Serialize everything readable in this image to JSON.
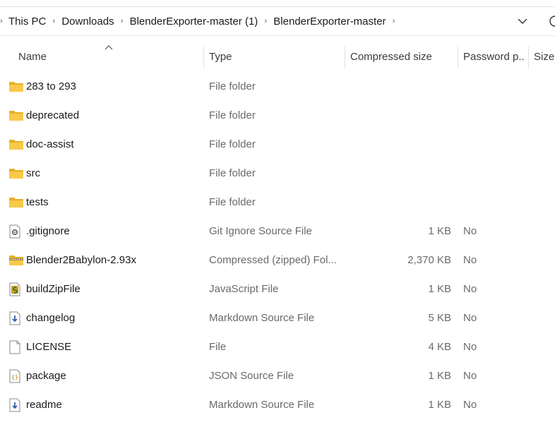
{
  "breadcrumb": {
    "items": [
      "This PC",
      "Downloads",
      "BlenderExporter-master (1)",
      "BlenderExporter-master"
    ]
  },
  "columns": {
    "name": "Name",
    "type": "Type",
    "compressed_size": "Compressed size",
    "password": "Password p...",
    "size": "Size"
  },
  "files": [
    {
      "name": "283 to 293",
      "type": "File folder",
      "compressed_size": "",
      "password": "",
      "icon": "folder-icon"
    },
    {
      "name": "deprecated",
      "type": "File folder",
      "compressed_size": "",
      "password": "",
      "icon": "folder-icon"
    },
    {
      "name": "doc-assist",
      "type": "File folder",
      "compressed_size": "",
      "password": "",
      "icon": "folder-icon"
    },
    {
      "name": "src",
      "type": "File folder",
      "compressed_size": "",
      "password": "",
      "icon": "folder-icon"
    },
    {
      "name": "tests",
      "type": "File folder",
      "compressed_size": "",
      "password": "",
      "icon": "folder-icon"
    },
    {
      "name": ".gitignore",
      "type": "Git Ignore Source File",
      "compressed_size": "1 KB",
      "password": "No",
      "icon": "gear-file-icon"
    },
    {
      "name": "Blender2Babylon-2.93x",
      "type": "Compressed (zipped) Fol...",
      "compressed_size": "2,370 KB",
      "password": "No",
      "icon": "zip-folder-icon"
    },
    {
      "name": "buildZipFile",
      "type": "JavaScript File",
      "compressed_size": "1 KB",
      "password": "No",
      "icon": "javascript-file-icon"
    },
    {
      "name": "changelog",
      "type": "Markdown Source File",
      "compressed_size": "5 KB",
      "password": "No",
      "icon": "markdown-file-icon"
    },
    {
      "name": "LICENSE",
      "type": "File",
      "compressed_size": "4 KB",
      "password": "No",
      "icon": "blank-file-icon"
    },
    {
      "name": "package",
      "type": "JSON Source File",
      "compressed_size": "1 KB",
      "password": "No",
      "icon": "json-file-icon"
    },
    {
      "name": "readme",
      "type": "Markdown Source File",
      "compressed_size": "1 KB",
      "password": "No",
      "icon": "markdown-file-icon"
    }
  ],
  "colors": {
    "folder": "#f8c94a",
    "folder_dark": "#e7ad26",
    "secondary_text": "#6a6a6a",
    "divider": "#e0e0e0"
  }
}
